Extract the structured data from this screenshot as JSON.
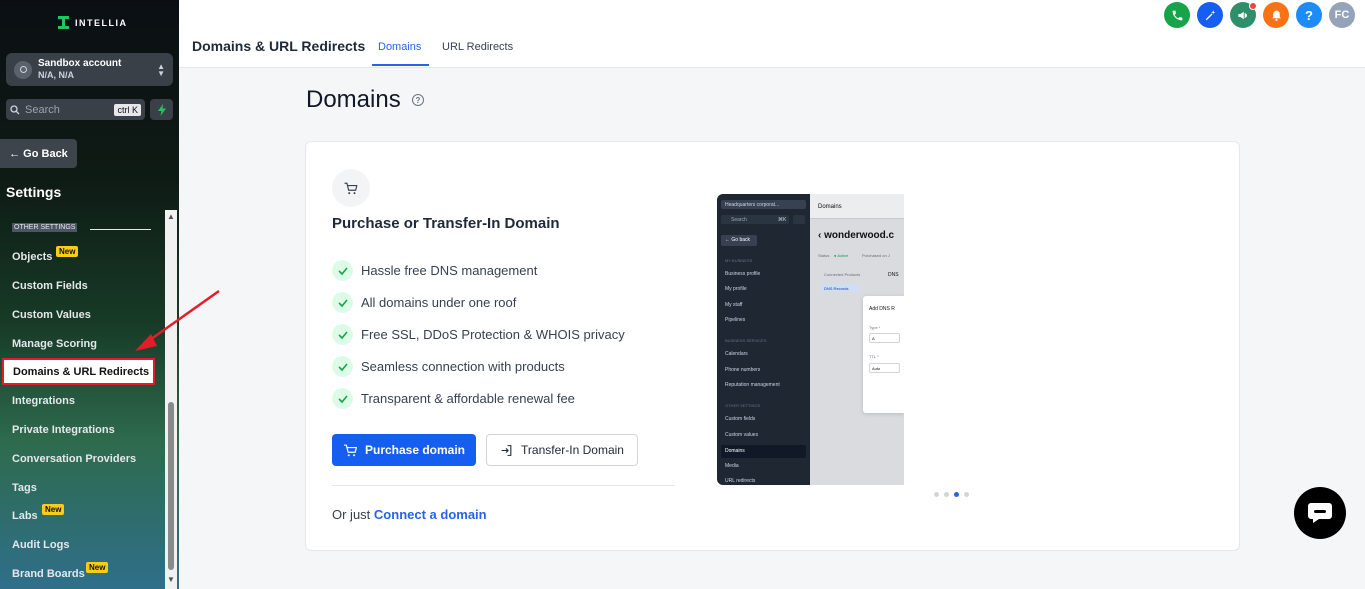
{
  "brand": {
    "name": "INTELLIA"
  },
  "account": {
    "name": "Sandbox account",
    "sub": "N/A, N/A"
  },
  "search": {
    "placeholder": "Search",
    "shortcut": "ctrl K"
  },
  "sidebar": {
    "go_back": "Go Back",
    "settings_title": "Settings",
    "section_label": "OTHER SETTINGS",
    "new_badge": "New",
    "items": [
      {
        "label": "Objects"
      },
      {
        "label": "Custom Fields"
      },
      {
        "label": "Custom Values"
      },
      {
        "label": "Manage Scoring"
      },
      {
        "label": "Domains & URL Redirects"
      },
      {
        "label": "Integrations"
      },
      {
        "label": "Private Integrations"
      },
      {
        "label": "Conversation Providers"
      },
      {
        "label": "Tags"
      },
      {
        "label": "Labs"
      },
      {
        "label": "Audit Logs"
      },
      {
        "label": "Brand Boards"
      }
    ]
  },
  "header": {
    "title": "Domains & URL Redirects",
    "tabs": [
      {
        "label": "Domains"
      },
      {
        "label": "URL Redirects"
      }
    ],
    "avatar": "FC",
    "help": "?",
    "icons": [
      "phone-icon",
      "magic-wand-icon",
      "megaphone-icon",
      "bell-icon",
      "help-icon",
      "avatar"
    ],
    "icon_colors": [
      "#16a34a",
      "#155eef",
      "#2f8f6a",
      "#f97316",
      "#1d8cf8",
      "#94a3b8"
    ]
  },
  "main": {
    "page_title": "Domains",
    "card": {
      "title": "Purchase or Transfer-In Domain",
      "features": [
        "Hassle free DNS management",
        "All domains under one roof",
        "Free SSL, DDoS Protection & WHOIS privacy",
        "Seamless connection with products",
        "Transparent & affordable renewal fee"
      ],
      "purchase_button": "Purchase domain",
      "transfer_button": "Transfer-In Domain",
      "connect_prefix": "Or just",
      "connect_link": "Connect a domain"
    },
    "preview": {
      "account": "Headquarters corporat...",
      "search": "Search",
      "kbd": "⌘K",
      "go_back": "Go back",
      "section_my_business": "MY BUSINESS",
      "business_items": [
        "Business profile",
        "My profile",
        "My staff",
        "Pipelines"
      ],
      "section_business_services": "BUSINESS SERVICES",
      "service_items": [
        "Calendars",
        "Phone numbers",
        "Reputation management"
      ],
      "section_other": "OTHER SETTINGS",
      "other_items": [
        "Custom fields",
        "Custom values",
        "Domains",
        "Media",
        "URL redirects"
      ],
      "header": "Domains",
      "domain": "wonderwood.c",
      "status_label": "Status",
      "status_value": "Active",
      "purchased": "Purchased on J",
      "connected_products": "Connected Products",
      "dns_tab": "DNS",
      "dns_records": "DNS Records",
      "modal_title": "Add DNS R",
      "type_label": "Type *",
      "type_value": "A",
      "ttl_label": "TTL *",
      "ttl_value": "Auto"
    },
    "carousel": {
      "active_index": 2,
      "count": 4
    }
  },
  "colors": {
    "primary": "#155eef",
    "success": "#22c55e",
    "annotation": "#e11d2a"
  }
}
